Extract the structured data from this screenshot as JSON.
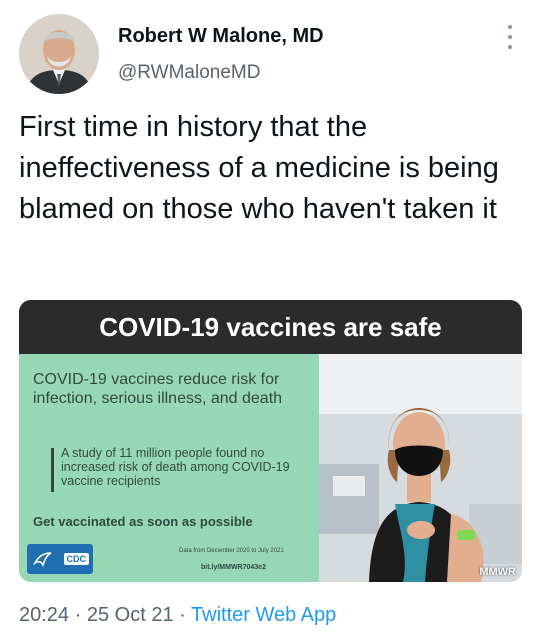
{
  "author": {
    "name": "Robert W Malone, MD",
    "handle": "@RWMaloneMD"
  },
  "tweet": {
    "text": "First time in history that the ineffectiveness of a medicine is being blamed on those who haven't taken it"
  },
  "media": {
    "headline": "COVID-19 vaccines are safe",
    "lead": "COVID-19 vaccines reduce risk for infection, serious illness, and death",
    "study": "A study of 11 million people found no increased risk of death among COVID-19 vaccine recipients",
    "cta": "Get vaccinated as soon as possible",
    "logo_text": "CDC",
    "data_note": "Data from December 2020 to July 2021",
    "short_link": "bit.ly/MMWR7043e2",
    "watermark": "MMWR",
    "colors": {
      "panel_green": "#98d7b6",
      "header_dark": "#2b2b2b",
      "cdc_blue": "#1f6fb2"
    }
  },
  "meta": {
    "time": "20:24",
    "separator": "·",
    "date": "25 Oct 21",
    "app": "Twitter Web App"
  },
  "icons": {
    "more": "more-vertical-icon",
    "avatar": "avatar"
  }
}
